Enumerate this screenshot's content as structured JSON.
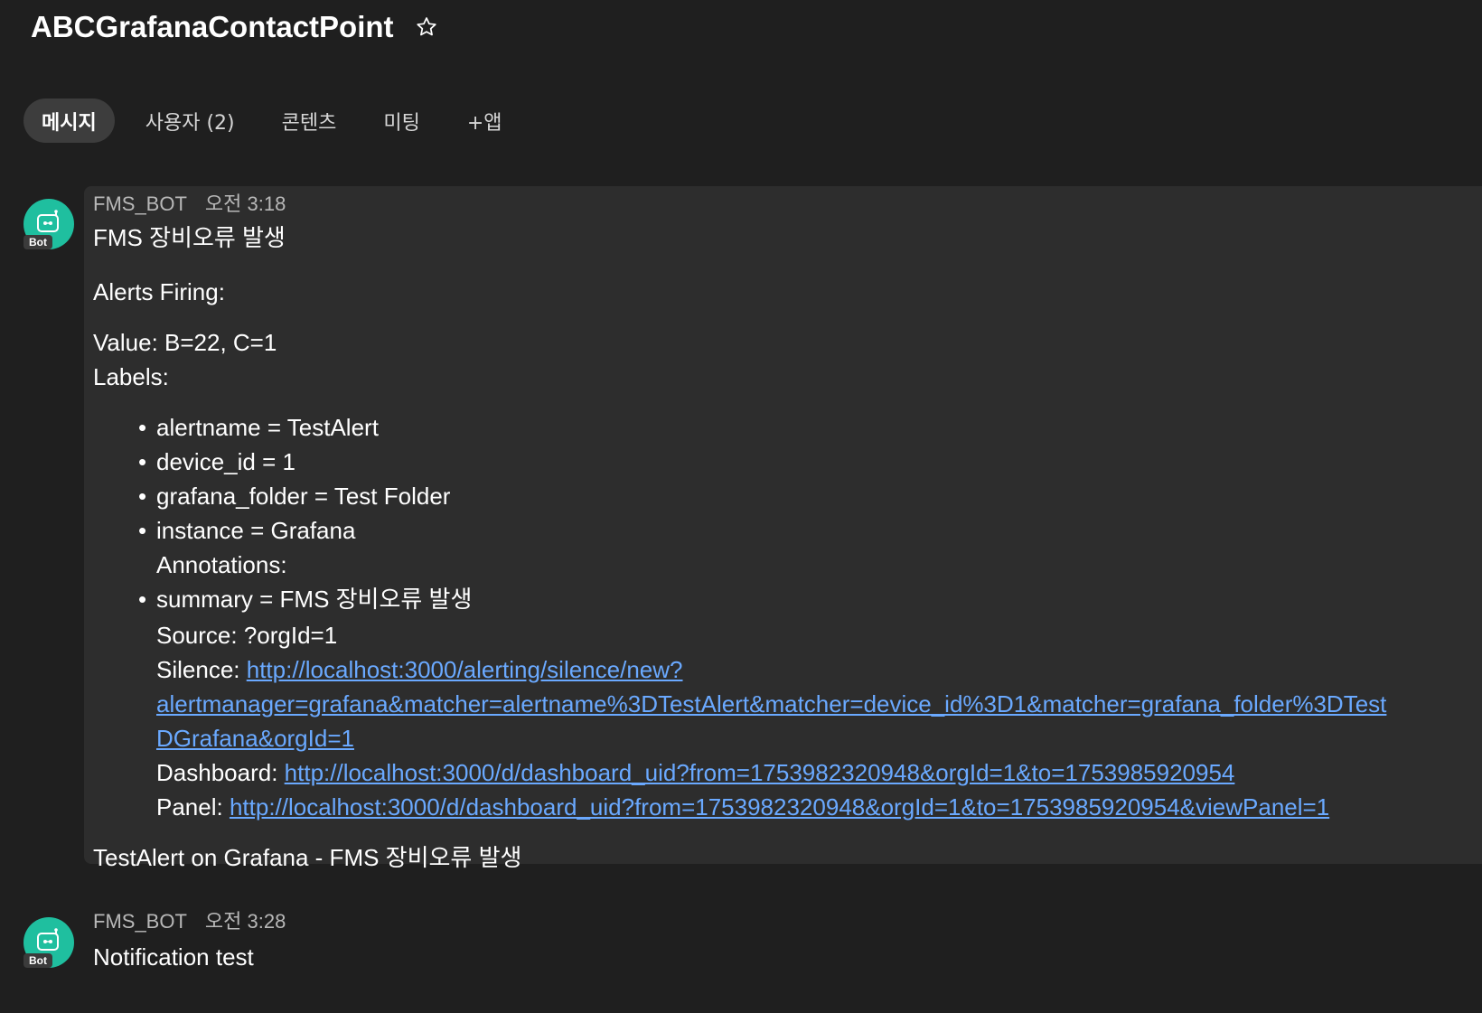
{
  "header": {
    "title": "ABCGrafanaContactPoint",
    "star_icon": "star-outline-icon"
  },
  "tabs": [
    {
      "label": "메시지",
      "active": true
    },
    {
      "label": "사용자 (2)",
      "active": false
    },
    {
      "label": "콘텐츠",
      "active": false
    },
    {
      "label": "미팅",
      "active": false
    },
    {
      "label": "+앱",
      "active": false
    }
  ],
  "messages": [
    {
      "sender": "FMS_BOT",
      "time": "오전 3:18",
      "avatar_badge": "Bot",
      "avatar_color": "#1fbf9f",
      "title": "FMS 장비오류 발생",
      "alerts_firing": "Alerts Firing:",
      "value": "Value: B=22, C=1",
      "labels_heading": "Labels:",
      "labels": [
        "alertname = TestAlert",
        "device_id = 1",
        "grafana_folder = Test Folder",
        "instance = Grafana"
      ],
      "annotations_heading": "Annotations:",
      "summary": "summary = FMS 장비오류 발생",
      "source": "Source: ?orgId=1",
      "silence_label": "Silence: ",
      "silence_link_line1": "http://localhost:3000/alerting/silence/new?",
      "silence_link_line2": "alertmanager=grafana&matcher=alertname%3DTestAlert&matcher=device_id%3D1&matcher=grafana_folder%3DTest",
      "silence_link_line3": "DGrafana&orgId=1",
      "dashboard_label": "Dashboard: ",
      "dashboard_link": "http://localhost:3000/d/dashboard_uid?from=1753982320948&orgId=1&to=1753985920954",
      "panel_label": "Panel: ",
      "panel_link": "http://localhost:3000/d/dashboard_uid?from=1753982320948&orgId=1&to=1753985920954&viewPanel=1",
      "footer": "TestAlert on Grafana - FMS 장비오류 발생"
    },
    {
      "sender": "FMS_BOT",
      "time": "오전 3:28",
      "avatar_badge": "Bot",
      "avatar_color": "#1fbf9f",
      "title": "Notification test"
    }
  ],
  "colors": {
    "background": "#1f1f1f",
    "bubble": "#2d2d2d",
    "active_tab": "#3d3d3d",
    "link": "#6aa9ff"
  }
}
